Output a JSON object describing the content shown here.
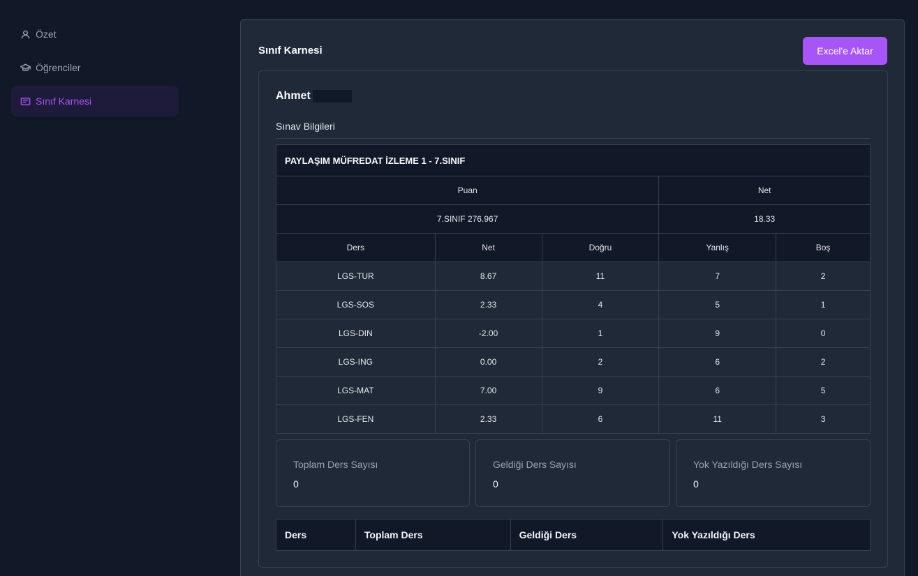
{
  "sidebar": {
    "items": [
      {
        "label": "Özet",
        "icon": "user-icon",
        "active": false
      },
      {
        "label": "Öğrenciler",
        "icon": "graduation-cap-icon",
        "active": false
      },
      {
        "label": "Sınıf Karnesi",
        "icon": "classroom-icon",
        "active": true
      }
    ]
  },
  "header": {
    "title": "Sınıf Karnesi",
    "export_label": "Excel'e Aktar"
  },
  "student": {
    "name": "Ahmet",
    "section_label": "Sınav Bilgileri"
  },
  "exam": {
    "title": "PAYLAŞIM MÜFREDAT İZLEME 1 - 7.SINIF",
    "puan_header": "Puan",
    "net_header": "Net",
    "puan_value": "7.SINIF 276.967",
    "net_value": "18.33",
    "columns": [
      "Ders",
      "Net",
      "Doğru",
      "Yanlış",
      "Boş"
    ],
    "rows": [
      [
        "LGS-TUR",
        "8.67",
        "11",
        "7",
        "2"
      ],
      [
        "LGS-SOS",
        "2.33",
        "4",
        "5",
        "1"
      ],
      [
        "LGS-DIN",
        "-2.00",
        "1",
        "9",
        "0"
      ],
      [
        "LGS-ING",
        "0.00",
        "2",
        "6",
        "2"
      ],
      [
        "LGS-MAT",
        "7.00",
        "9",
        "6",
        "5"
      ],
      [
        "LGS-FEN",
        "2.33",
        "6",
        "11",
        "3"
      ]
    ]
  },
  "stats": [
    {
      "label": "Toplam Ders Sayısı",
      "value": "0"
    },
    {
      "label": "Geldiği Ders Sayısı",
      "value": "0"
    },
    {
      "label": "Yok Yazıldığı Ders Sayısı",
      "value": "0"
    }
  ],
  "attendance_table": {
    "columns": [
      "Ders",
      "Toplam Ders",
      "Geldiği Ders",
      "Yok Yazıldığı Ders"
    ]
  },
  "colors": {
    "accent": "#a855f7",
    "background": "#111827",
    "panel": "#1f2937"
  }
}
